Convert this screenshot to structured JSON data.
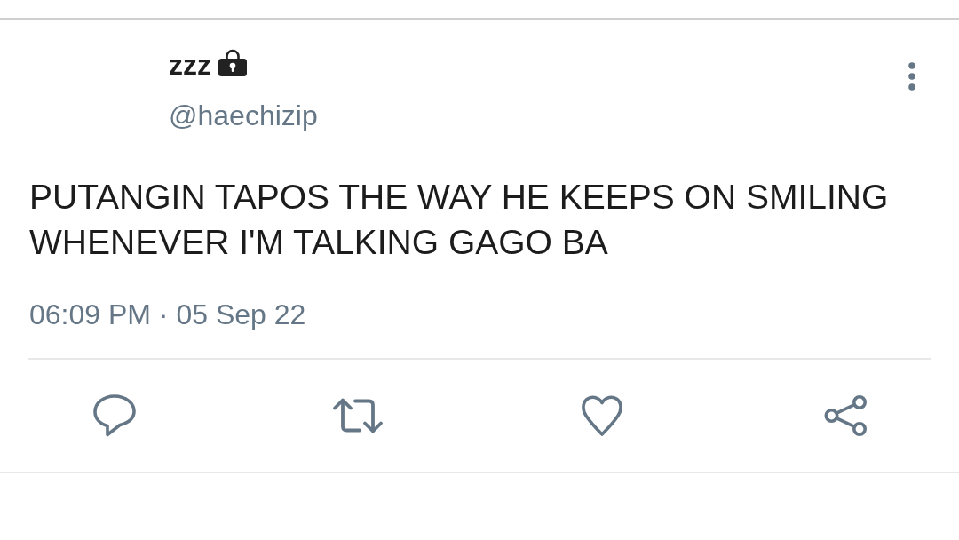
{
  "tweet": {
    "author": {
      "name": "zzz",
      "protected": true,
      "handle": "@haechizip"
    },
    "text": "PUTANGIN TAPOS THE WAY HE KEEPS ON SMILING WHENEVER I'M TALKING GAGO BA",
    "timestamp": "06:09 PM · 05 Sep 22",
    "actions": [
      {
        "kind": "reply"
      },
      {
        "kind": "retweet"
      },
      {
        "kind": "like"
      },
      {
        "kind": "share"
      }
    ]
  }
}
